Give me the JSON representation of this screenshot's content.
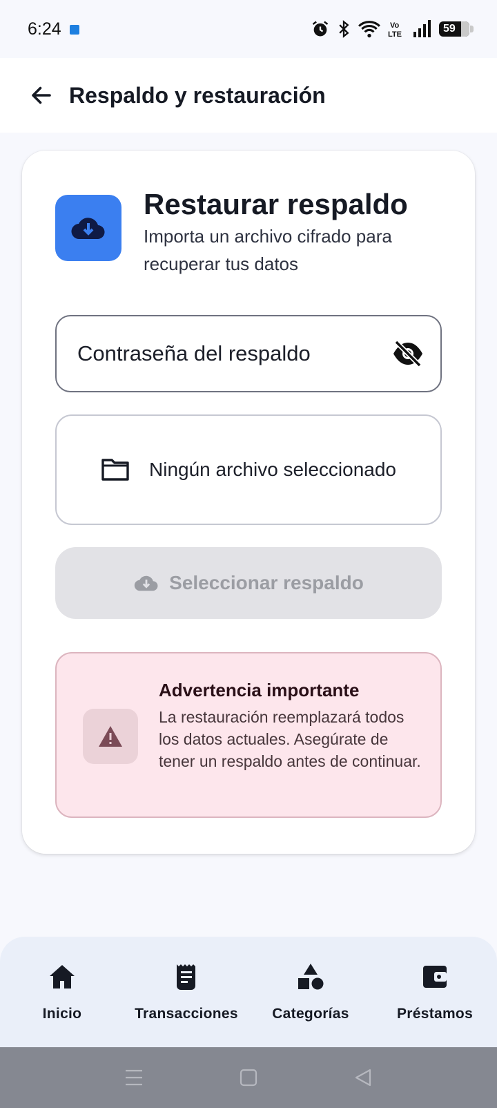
{
  "status_bar": {
    "time": "6:24",
    "battery": "59"
  },
  "app_bar": {
    "title": "Respaldo y restauración"
  },
  "card": {
    "title": "Restaurar respaldo",
    "subtitle": "Importa un archivo cifrado para recuperar tus datos",
    "password_label": "Contraseña del respaldo",
    "file_status": "Ningún archivo seleccionado",
    "select_button": "Seleccionar respaldo",
    "warning": {
      "title": "Advertencia importante",
      "body": "La restauración reemplazará todos los datos actuales. Asegúrate de tener un respaldo antes de continuar."
    }
  },
  "bottom_nav": {
    "items": [
      {
        "label": "Inicio",
        "icon": "home-icon"
      },
      {
        "label": "Transacciones",
        "icon": "receipt-icon"
      },
      {
        "label": "Categorías",
        "icon": "shapes-icon"
      },
      {
        "label": "Préstamos",
        "icon": "wallet-icon"
      }
    ]
  },
  "colors": {
    "accent": "#3b7ff0",
    "warning_bg": "#fde6ec",
    "disabled_button": "#e2e2e6"
  }
}
